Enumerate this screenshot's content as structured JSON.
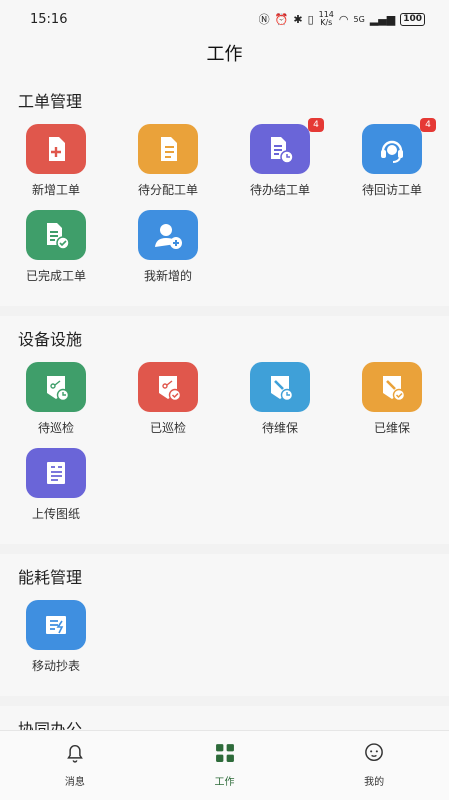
{
  "status": {
    "time": "15:16",
    "speed_value": "114",
    "speed_unit": "K/s",
    "signal": "5G",
    "battery": "100"
  },
  "title": "工作",
  "sections": [
    {
      "title": "工单管理",
      "items": [
        {
          "label": "新增工单",
          "color": "#e0574c",
          "icon": "file-plus-icon"
        },
        {
          "label": "待分配工单",
          "color": "#eaa23a",
          "icon": "document-icon"
        },
        {
          "label": "待办结工单",
          "color": "#6a65d8",
          "icon": "document-clock-icon",
          "badge": "4"
        },
        {
          "label": "待回访工单",
          "color": "#3f8fe0",
          "icon": "headset-icon",
          "badge": "4"
        },
        {
          "label": "已完成工单",
          "color": "#3f9e6a",
          "icon": "document-check-icon"
        },
        {
          "label": "我新增的",
          "color": "#3f8fe0",
          "icon": "user-add-icon"
        }
      ]
    },
    {
      "title": "设备设施",
      "items": [
        {
          "label": "待巡检",
          "color": "#3f9e6a",
          "icon": "patrol-clock-icon"
        },
        {
          "label": "已巡检",
          "color": "#e0574c",
          "icon": "patrol-check-icon"
        },
        {
          "label": "待维保",
          "color": "#3fa0d8",
          "icon": "wrench-clock-icon"
        },
        {
          "label": "已维保",
          "color": "#eaa23a",
          "icon": "wrench-check-icon"
        },
        {
          "label": "上传图纸",
          "color": "#6a65d8",
          "icon": "drawing-icon"
        }
      ]
    },
    {
      "title": "能耗管理",
      "items": [
        {
          "label": "移动抄表",
          "color": "#3f8fe0",
          "icon": "meter-icon"
        }
      ]
    },
    {
      "title": "协同办公",
      "items": [
        {
          "label": "",
          "color": "#3f8fe0",
          "icon": "office-icon"
        },
        {
          "label": "",
          "color": "#eaa23a",
          "icon": "office-icon"
        },
        {
          "label": "",
          "color": "#3f8fe0",
          "icon": "office-icon"
        },
        {
          "label": "",
          "color": "#e0744c",
          "icon": "office-icon"
        }
      ]
    }
  ],
  "tabs": [
    {
      "label": "消息",
      "icon": "bell-icon"
    },
    {
      "label": "工作",
      "icon": "grid-icon",
      "active": true,
      "color": "#2e6b3a"
    },
    {
      "label": "我的",
      "icon": "face-icon"
    }
  ]
}
